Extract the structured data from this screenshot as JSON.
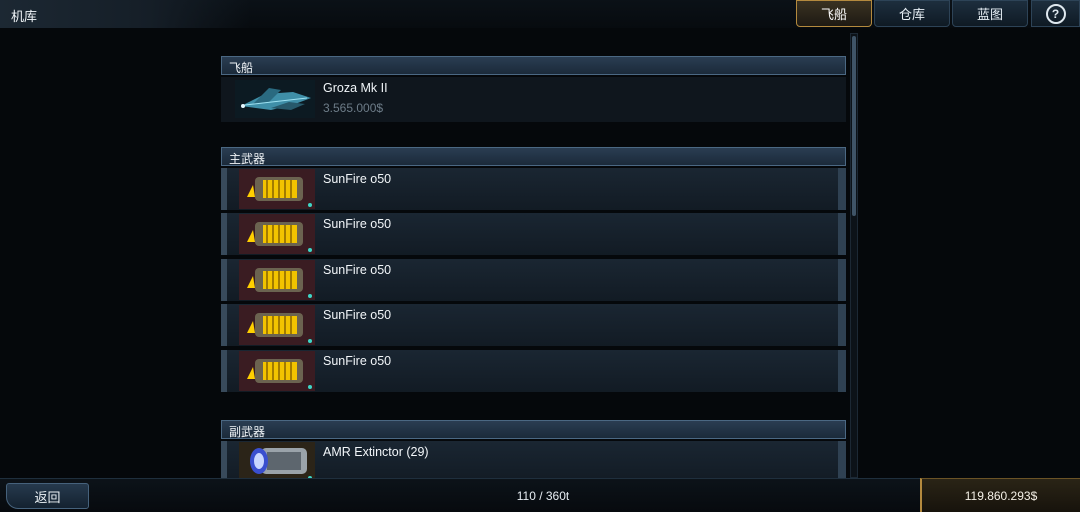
{
  "header": {
    "title": "机库"
  },
  "tabs": [
    {
      "label": "飞船",
      "active": true
    },
    {
      "label": "仓库",
      "active": false
    },
    {
      "label": "蓝图",
      "active": false
    }
  ],
  "help_icon": "question-mark-icon",
  "sections": {
    "ship": {
      "header": "飞船",
      "name": "Groza Mk II",
      "price": "3.565.000$"
    },
    "primary": {
      "header": "主武器",
      "items": [
        "SunFire o50",
        "SunFire o50",
        "SunFire o50",
        "SunFire o50",
        "SunFire o50"
      ]
    },
    "secondary": {
      "header": "副武器",
      "items": [
        "AMR Extinctor (29)"
      ]
    }
  },
  "footer": {
    "back_label": "返回",
    "capacity": "110 / 360t",
    "money": "119.860.293$"
  },
  "colors": {
    "accent_gold": "#b48a3e",
    "slot_dot": "#3fd6c7",
    "panel_blue": "#1b2a3a"
  }
}
